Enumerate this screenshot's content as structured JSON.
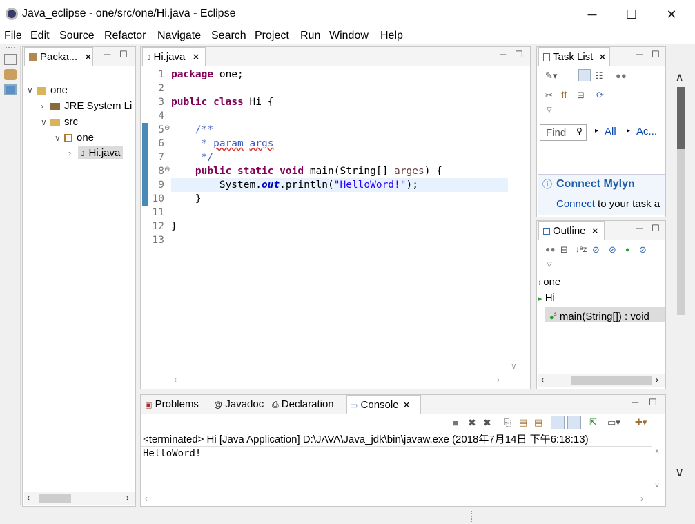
{
  "window": {
    "title": "Java_eclipse - one/src/one/Hi.java - Eclipse",
    "min": "─",
    "max": "☐",
    "close": "✕"
  },
  "menu": [
    "File",
    "Edit",
    "Source",
    "Refactor",
    "Navigate",
    "Search",
    "Project",
    "Run",
    "Window",
    "Help"
  ],
  "package_explorer": {
    "tab_label": "Packa...",
    "tree": [
      {
        "label": "one"
      },
      {
        "label": "JRE System Li"
      },
      {
        "label": "src"
      },
      {
        "label": "one"
      },
      {
        "label": "Hi.java"
      }
    ]
  },
  "editor": {
    "tab_label": "Hi.java",
    "lines": [
      {
        "n": "1"
      },
      {
        "n": "2"
      },
      {
        "n": "3"
      },
      {
        "n": "4"
      },
      {
        "n": "5"
      },
      {
        "n": "6"
      },
      {
        "n": "7"
      },
      {
        "n": "8"
      },
      {
        "n": "9"
      },
      {
        "n": "10"
      },
      {
        "n": "11"
      },
      {
        "n": "12"
      },
      {
        "n": "13"
      }
    ],
    "code": {
      "l1_kw": "package",
      "l1_rest": " one;",
      "l3_kw1": "public",
      "l3_kw2": "class",
      "l3_rest": " Hi {",
      "l5": "    /**",
      "l6_pre": "     * ",
      "l6_param": "param",
      "l6_args": "args",
      "l7": "     */",
      "l8_pre": "    ",
      "l8_kw1": "public",
      "l8_kw2": "static",
      "l8_kw3": "void",
      "l8_rest": " main(String[] ",
      "l8_var": "arges",
      "l8_end": ") {",
      "l9_pre": "        System.",
      "l9_fld": "out",
      "l9_mid": ".println(",
      "l9_str": "\"HelloWord!\"",
      "l9_end": ");",
      "l10": "    }",
      "l12": "}"
    }
  },
  "task_list": {
    "tab_label": "Task List",
    "find_placeholder": "Find",
    "all_label": "All",
    "ac_label": "Ac...",
    "mylyn_title": "Connect Mylyn",
    "mylyn_link": "Connect",
    "mylyn_text": " to your task a"
  },
  "outline": {
    "tab_label": "Outline",
    "items": [
      {
        "label": "one"
      },
      {
        "label": "Hi"
      },
      {
        "label": "main(String[]) : void"
      }
    ]
  },
  "bottom": {
    "tabs": [
      {
        "label": "Problems"
      },
      {
        "label": "Javadoc"
      },
      {
        "label": "Declaration"
      },
      {
        "label": "Console"
      }
    ],
    "terminated": "<terminated> Hi [Java Application] D:\\JAVA\\Java_jdk\\bin\\javaw.exe (2018年7月14日 下午6:18:13)",
    "output": "HelloWord!"
  }
}
